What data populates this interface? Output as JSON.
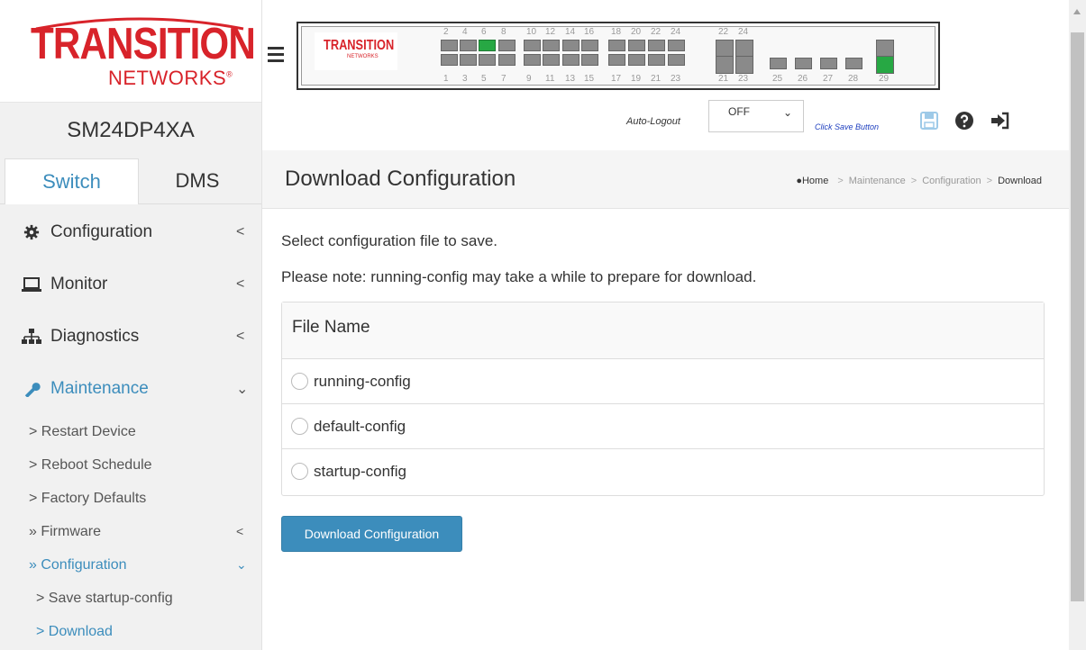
{
  "logo": {
    "main": "TRANSITION",
    "sub": "NETWORKS"
  },
  "device_name": "SM24DP4XA",
  "tabs": [
    {
      "label": "Switch"
    },
    {
      "label": "DMS"
    }
  ],
  "menu": [
    {
      "label": "Configuration",
      "icon": "gear-icon",
      "chevron": "<"
    },
    {
      "label": "Monitor",
      "icon": "laptop-icon",
      "chevron": "<"
    },
    {
      "label": "Diagnostics",
      "icon": "sitemap-icon",
      "chevron": "<"
    },
    {
      "label": "Maintenance",
      "icon": "wrench-icon",
      "chevron": "⌄"
    }
  ],
  "submenu": [
    {
      "label": "> Restart Device"
    },
    {
      "label": "> Reboot Schedule"
    },
    {
      "label": "> Factory Defaults"
    },
    {
      "label": "» Firmware",
      "chevron": "<"
    },
    {
      "label": "» Configuration",
      "chevron": "⌄"
    },
    {
      "label": "> Save startup-config"
    },
    {
      "label": "> Download"
    }
  ],
  "panel": {
    "mini_logo_main": "TRANSITION",
    "mini_logo_sub": "NETWORKS",
    "top_numbers": [
      "2",
      "4",
      "6",
      "8",
      "10",
      "12",
      "14",
      "16",
      "18",
      "20",
      "22",
      "24",
      "22",
      "24"
    ],
    "bottom_numbers": [
      "1",
      "3",
      "5",
      "7",
      "9",
      "11",
      "13",
      "15",
      "17",
      "19",
      "21",
      "23",
      "21",
      "23",
      "25",
      "26",
      "27",
      "28",
      "29"
    ],
    "active_ports": [
      "6",
      "29"
    ]
  },
  "topbar": {
    "autologout_label": "Auto-Logout",
    "autologout_value": "OFF",
    "save_hint": "Click Save Button"
  },
  "header": {
    "title": "Download Configuration",
    "breadcrumb": {
      "home": "Home",
      "items": [
        "Maintenance",
        "Configuration"
      ],
      "current": "Download"
    }
  },
  "content": {
    "line1": "Select configuration file to save.",
    "line2": "Please note: running-config may take a while to prepare for download.",
    "table_header": "File Name",
    "files": [
      "running-config",
      "default-config",
      "startup-config"
    ],
    "button": "Download Configuration"
  },
  "colors": {
    "accent": "#3c8dbc",
    "brand": "#d8232a",
    "port_up": "#27a844"
  }
}
